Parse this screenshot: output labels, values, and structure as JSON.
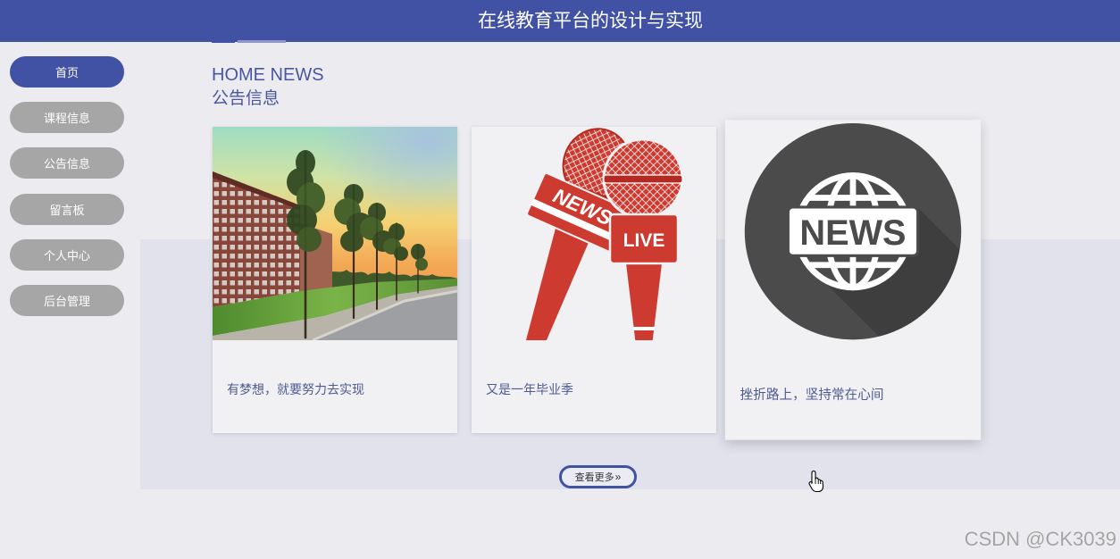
{
  "theme": {
    "primary": "#4152a4",
    "page_bg": "#ececf0",
    "section_bg": "#e1e2ec",
    "nav_inactive": "#a6a6a6",
    "heading": "#4a56a0",
    "card_text": "#4e5a92",
    "card_bg": "#f1f1f4",
    "mic_red": "#cd3a2f",
    "globe_gray": "#4b4b4b",
    "watermark": "#a3a3a3"
  },
  "header": {
    "title": "在线教育平台的设计与实现"
  },
  "sidebar": {
    "items": [
      {
        "label": "首页",
        "active": true
      },
      {
        "label": "课程信息",
        "active": false
      },
      {
        "label": "公告信息",
        "active": false
      },
      {
        "label": "留言板",
        "active": false
      },
      {
        "label": "个人中心",
        "active": false
      },
      {
        "label": "后台管理",
        "active": false
      }
    ]
  },
  "news": {
    "heading_en": "HOME NEWS",
    "heading_cn": "公告信息",
    "cards": [
      {
        "title": "有梦想，就要努力去实现"
      },
      {
        "title": "又是一年毕业季",
        "image_text": [
          "NEWS",
          "LIVE"
        ]
      },
      {
        "title": "挫折路上，坚持常在心间",
        "image_text": [
          "NEWS"
        ]
      }
    ],
    "more_button": {
      "label": "查看更多",
      "glyph": "»",
      "icon": "double-chevron-right-icon"
    }
  },
  "cursor": {
    "icon": "hand-pointer-icon"
  },
  "watermark": {
    "text": "CSDN @CK3039"
  }
}
